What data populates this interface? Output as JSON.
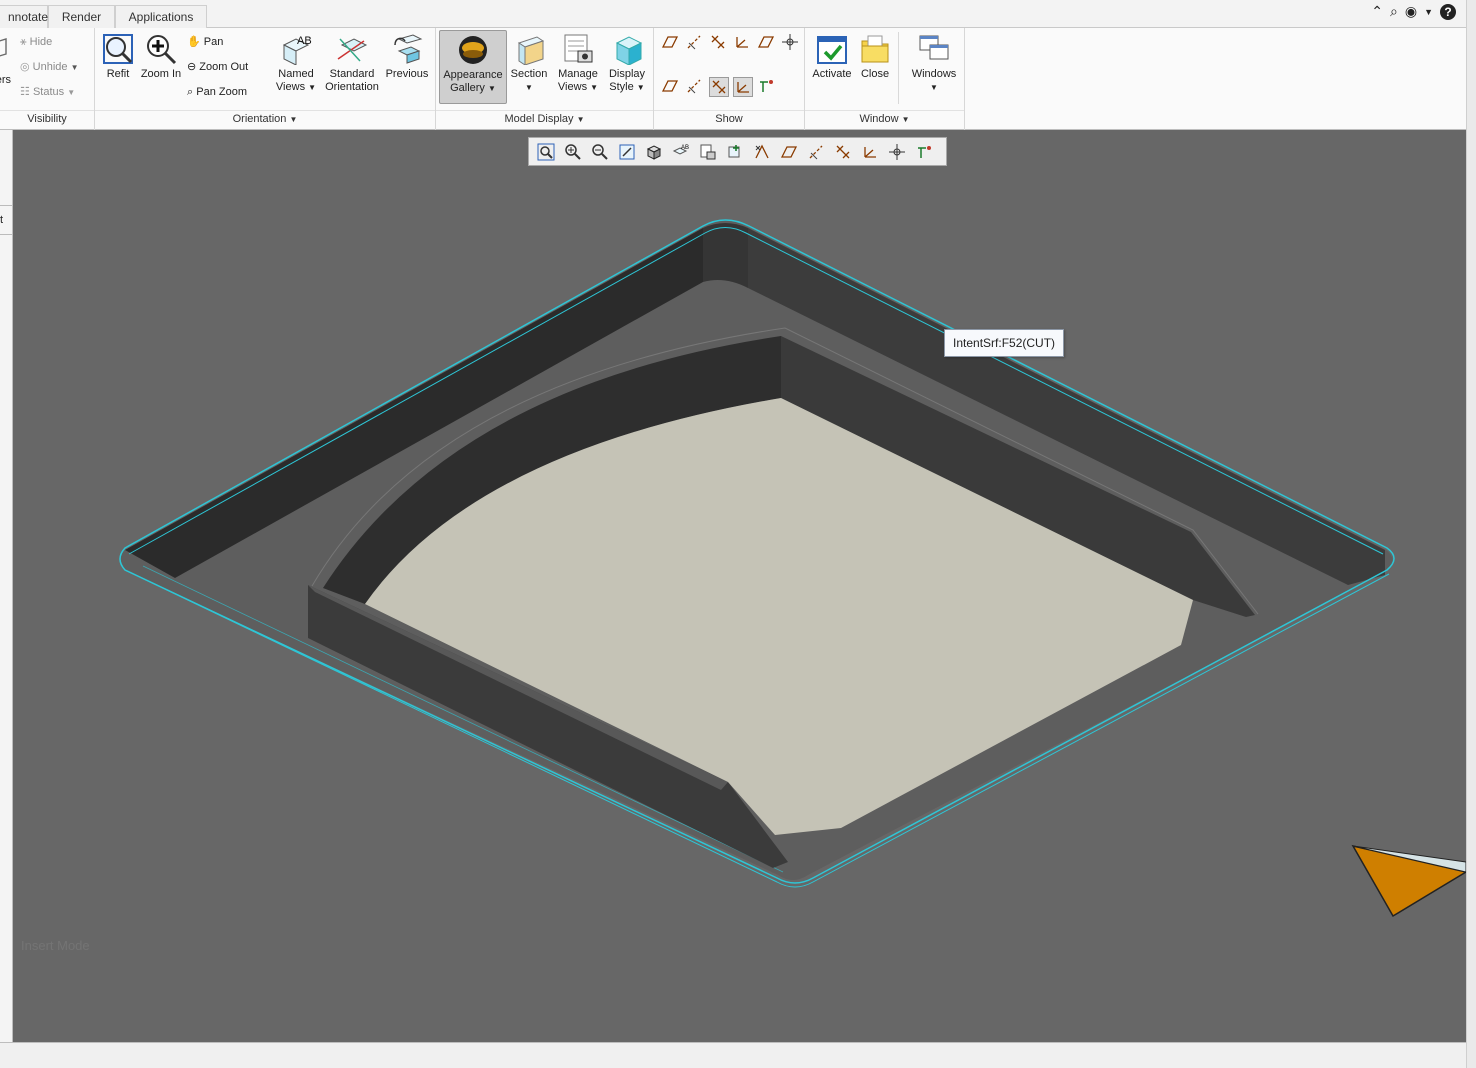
{
  "tabs": [
    "nnotate",
    "Render",
    "Applications"
  ],
  "ribbon": {
    "visibility": {
      "layers": "ers",
      "hide": "Hide",
      "unhide": "Unhide",
      "status": "Status",
      "label": "Visibility"
    },
    "orientation": {
      "refit": "Refit",
      "zoom_in": "Zoom In",
      "pan": "Pan",
      "zoom_out": "Zoom Out",
      "pan_zoom": "Pan Zoom",
      "named_views_1": "Named",
      "named_views_2": "Views",
      "standard_1": "Standard",
      "standard_2": "Orientation",
      "previous": "Previous",
      "label": "Orientation"
    },
    "model_display": {
      "appearance_1": "Appearance",
      "appearance_2": "Gallery",
      "section": "Section",
      "manage_1": "Manage",
      "manage_2": "Views",
      "display_1": "Display",
      "display_2": "Style",
      "label": "Model Display"
    },
    "show": {
      "label": "Show",
      "icons": [
        "plane-display-icon",
        "axis-display-icon",
        "point-display-icon",
        "csys-display-icon",
        "plane-tag-icon",
        "spin-center-icon",
        "plane-tag-display-icon",
        "axis-tag-display-icon",
        "point-tag-display-icon",
        "csys-tag-display-icon",
        "annotation-display-icon"
      ]
    },
    "window": {
      "activate": "Activate",
      "close": "Close",
      "windows": "Windows",
      "label": "Window"
    }
  },
  "view_toolbar": [
    "refit-icon",
    "zoom-in-icon",
    "zoom-out-icon",
    "repaint-icon",
    "display-style-icon",
    "named-views-icon",
    "manage-views-icon",
    "view-normal-icon",
    "datum-display-icon",
    "plane-display-icon",
    "axis-display-icon",
    "point-display-icon",
    "csys-display-icon",
    "spin-center-icon",
    "annotation-display-icon"
  ],
  "viewport": {
    "tooltip": "IntentSrf:F52(CUT)",
    "insert_mode": "Insert Mode"
  },
  "colors": {
    "viewport_bg": "#676767",
    "selection_highlight": "#2ec6d6",
    "pocket_floor": "#c5c3b6",
    "view_cube": "#cf7f00"
  }
}
